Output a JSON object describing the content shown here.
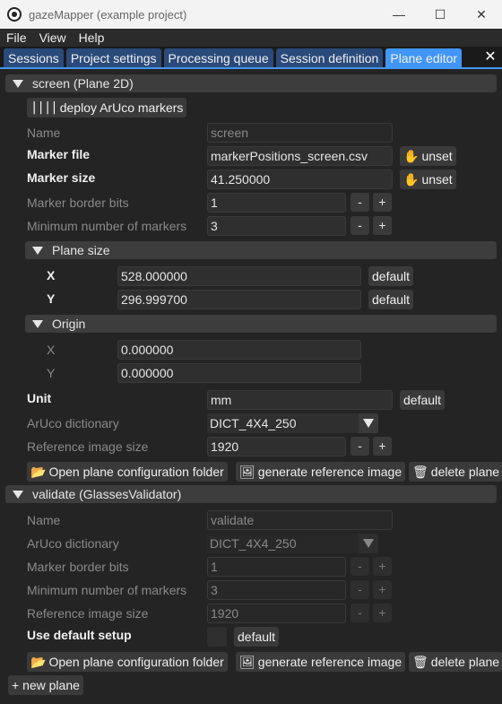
{
  "window": {
    "title": "gazeMapper (example project)",
    "buttons": {
      "minimize": "—",
      "maximize": "☐",
      "close": "✕"
    }
  },
  "menu": [
    "File",
    "View",
    "Help"
  ],
  "tabs": [
    {
      "label": "Sessions",
      "active": false
    },
    {
      "label": "Project settings",
      "active": false
    },
    {
      "label": "Processing queue",
      "active": false
    },
    {
      "label": "Session definition",
      "active": false
    },
    {
      "label": "Plane editor",
      "active": true
    }
  ],
  "tab_close": "✕",
  "plane1": {
    "header": "screen (Plane 2D)",
    "deploy_button": "deploy ArUco markers",
    "name": {
      "label": "Name",
      "value": "screen"
    },
    "marker_file": {
      "label": "Marker file",
      "value": "markerPositions_screen.csv",
      "unset": "unset"
    },
    "marker_size": {
      "label": "Marker size",
      "value": "41.250000",
      "unset": "unset"
    },
    "marker_border_bits": {
      "label": "Marker border bits",
      "value": "1"
    },
    "min_markers": {
      "label": "Minimum number of markers",
      "value": "3"
    },
    "plane_size": {
      "header": "Plane size",
      "x": {
        "label": "X",
        "value": "528.000000",
        "default": "default"
      },
      "y": {
        "label": "Y",
        "value": "296.999700",
        "default": "default"
      }
    },
    "origin": {
      "header": "Origin",
      "x": {
        "label": "X",
        "value": "0.000000"
      },
      "y": {
        "label": "Y",
        "value": "0.000000"
      }
    },
    "unit": {
      "label": "Unit",
      "value": "mm",
      "default": "default"
    },
    "aruco_dict": {
      "label": "ArUco dictionary",
      "value": "DICT_4X4_250"
    },
    "ref_image_size": {
      "label": "Reference image size",
      "value": "1920"
    },
    "open_folder": "Open plane configuration folder",
    "generate_ref": "generate reference image",
    "delete": "delete plane"
  },
  "plane2": {
    "header": "validate (GlassesValidator)",
    "name": {
      "label": "Name",
      "value": "validate"
    },
    "aruco_dict": {
      "label": "ArUco dictionary",
      "value": "DICT_4X4_250"
    },
    "marker_border_bits": {
      "label": "Marker border bits",
      "value": "1"
    },
    "min_markers": {
      "label": "Minimum number of markers",
      "value": "3"
    },
    "ref_image_size": {
      "label": "Reference image size",
      "value": "1920"
    },
    "use_default": {
      "label": "Use default setup",
      "default": "default"
    },
    "open_folder": "Open plane configuration folder",
    "generate_ref": "generate reference image",
    "delete": "delete plane"
  },
  "new_plane": "+ new plane",
  "stepper": {
    "minus": "-",
    "plus": "+"
  }
}
